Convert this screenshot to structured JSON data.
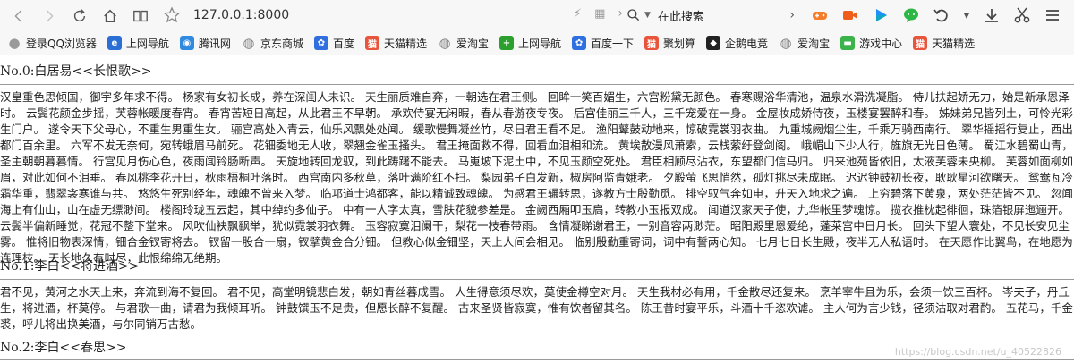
{
  "browser": {
    "url": "127.0.0.1:8000",
    "search_placeholder": "在此搜索",
    "colors": {
      "toolbar_bg": "#f7f7f7",
      "game": "#f47c2a",
      "video": "#f05c1a",
      "play": "#1e90ff",
      "chat": "#2db744"
    }
  },
  "bookmarks": [
    {
      "label": "登录QQ浏览器",
      "icon": "user-icon",
      "color": "#9a9a9a"
    },
    {
      "label": "上网导航",
      "icon": "ie-icon",
      "color": "#2b6fd6"
    },
    {
      "label": "腾讯网",
      "icon": "tencent-icon",
      "color": "#2f8ae0"
    },
    {
      "label": "京东商城",
      "icon": "globe-icon",
      "color": "#888888"
    },
    {
      "label": "百度",
      "icon": "baidu-icon",
      "color": "#2f6fe0"
    },
    {
      "label": "天猫精选",
      "icon": "tmall-icon",
      "color": "#e8553c"
    },
    {
      "label": "爱淘宝",
      "icon": "globe-icon",
      "color": "#888888"
    },
    {
      "label": "上网导航",
      "icon": "nav-plus-icon",
      "color": "#2ca02c"
    },
    {
      "label": "百度一下",
      "icon": "baidu-icon",
      "color": "#2f6fe0"
    },
    {
      "label": "聚划算",
      "icon": "tmall-icon",
      "color": "#e8553c"
    },
    {
      "label": "企鹅电竞",
      "icon": "penguin-icon",
      "color": "#222222"
    },
    {
      "label": "爱淘宝",
      "icon": "globe-icon",
      "color": "#888888"
    },
    {
      "label": "游戏中心",
      "icon": "gamepad-icon",
      "color": "#3bb34a"
    },
    {
      "label": "天猫精选",
      "icon": "tmall-icon",
      "color": "#e8553c"
    }
  ],
  "poems": [
    {
      "title": "No.0:白居易<<长恨歌>>",
      "body": "汉皇重色思倾国，御宇多年求不得。 杨家有女初长成，养在深闺人未识。 天生丽质难自弃，一朝选在君王侧。 回眸一笑百媚生，六宫粉黛无颜色。 春寒赐浴华清池，温泉水滑洗凝脂。 侍儿扶起娇无力，始是新承恩泽时。 云鬓花颜金步摇，芙蓉帐暖度春宵。 春宵苦短日高起，从此君王不早朝。 承欢侍宴无闲暇，春从春游夜专夜。 后宫佳丽三千人，三千宠爱在一身。 金屋妆成娇侍夜，玉楼宴罢醉和春。 姊妹弟兄皆列土，可怜光彩生门户。 遂令天下父母心，不重生男重生女。 骊宫高处入青云，仙乐风飘处处闻。 缓歌慢舞凝丝竹，尽日君王看不足。 渔阳鼙鼓动地来，惊破霓裳羽衣曲。 九重城阙烟尘生，千乘万骑西南行。 翠华摇摇行复止，西出都门百余里。 六军不发无奈何，宛转蛾眉马前死。 花钿委地无人收，翠翘金雀玉搔头。 君王掩面救不得，回看血泪相和流。 黄埃散漫风萧索，云栈萦纡登剑阁。 峨嵋山下少人行，旌旗无光日色薄。 蜀江水碧蜀山青，圣主朝朝暮暮情。 行宫见月伤心色，夜雨闻铃肠断声。 天旋地转回龙驭，到此踌躇不能去。 马嵬坡下泥土中，不见玉颜空死处。 君臣相顾尽沾衣，东望都门信马归。 归来池苑皆依旧，太液芙蓉未央柳。 芙蓉如面柳如眉，对此如何不泪垂。 春风桃李花开日，秋雨梧桐叶落时。 西宫南内多秋草，落叶满阶红不扫。 梨园弟子白发新，椒房阿监青娥老。 夕殿萤飞思悄然，孤灯挑尽未成眠。 迟迟钟鼓初长夜，耿耿星河欲曙天。 鸳鸯瓦冷霜华重，翡翠衾寒谁与共。 悠悠生死别经年，魂魄不曾来入梦。 临邛道士鸿都客，能以精诚致魂魄。 为感君王辗转思，遂教方士殷勤觅。 排空驭气奔如电，升天入地求之遍。 上穷碧落下黄泉，两处茫茫皆不见。 忽闻海上有仙山，山在虚无缥渺间。 楼阁玲珑五云起，其中绰约多仙子。 中有一人字太真，雪肤花貌参差是。 金阙西厢叩玉扃，转教小玉报双成。 闻道汉家天子使，九华帐里梦魂惊。 揽衣推枕起徘徊，珠箔银屏迤逦开。 云鬓半偏新睡觉，花冠不整下堂来。 风吹仙袂飘飖举，犹似霓裳羽衣舞。 玉容寂寞泪阑干，梨花一枝春带雨。 含情凝睇谢君王，一别音容两渺茫。 昭阳殿里恩爱绝，蓬莱宫中日月长。 回头下望人寰处，不见长安见尘雾。 惟将旧物表深情，钿合金钗寄将去。 钗留一股合一扇，钗擘黄金合分钿。 但教心似金钿坚，天上人间会相见。 临别殷勤重寄词，词中有誓两心知。 七月七日长生殿，夜半无人私语时。 在天愿作比翼鸟，在地愿为连理枝。 天长地久有时尽，此恨绵绵无绝期。"
    },
    {
      "title": "No.1:李白<<将进酒>>",
      "body": "君不见，黄河之水天上来，奔流到海不复回。 君不见，高堂明镜悲白发，朝如青丝暮成雪。 人生得意须尽欢，莫使金樽空对月。 天生我材必有用，千金散尽还复来。 烹羊宰牛且为乐，会须一饮三百杯。 岑夫子，丹丘生，将进酒，杯莫停。 与君歌一曲，请君为我倾耳听。 钟鼓馔玉不足贵，但愿长醉不复醒。 古来圣贤皆寂寞，惟有饮者留其名。 陈王昔时宴平乐，斗酒十千恣欢谑。 主人何为言少钱，径须沽取对君酌。 五花马，千金裘，呼儿将出换美酒，与尔同销万古愁。"
    },
    {
      "title": "No.2:李白<<春思>>",
      "body": ""
    }
  ],
  "watermark": "https://blog.csdn.net/u_40522826"
}
